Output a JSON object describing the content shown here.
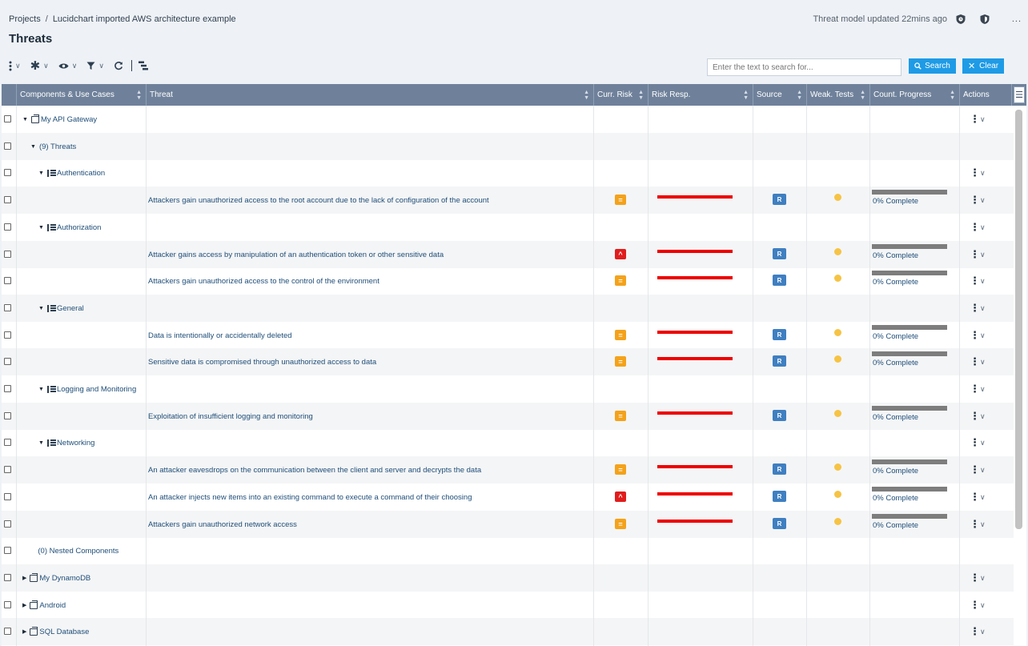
{
  "breadcrumb": {
    "root": "Projects",
    "sep": "/",
    "current": "Lucidchart imported AWS architecture example"
  },
  "page_title": "Threats",
  "header": {
    "updated": "Threat model updated 22mins ago",
    "more": "..."
  },
  "search": {
    "placeholder": "Enter the text to search for...",
    "search_label": "Search",
    "clear_label": "Clear"
  },
  "icons": {
    "search": "search-icon",
    "clear": "close-icon"
  },
  "columns": [
    "Components & Use Cases",
    "Threat",
    "Curr. Risk",
    "Risk Resp.",
    "Source",
    "Weak. Tests",
    "Count. Progress",
    "Actions"
  ],
  "colors": {
    "header_bg": "#6f819a",
    "accent": "#1e9be6",
    "risk_medium": "#f4a21b",
    "risk_high": "#e11d1d",
    "risk_response": "#ee0000",
    "test_dot": "#f6c343",
    "source_badge": "#3f7fc1"
  },
  "rows": [
    {
      "type": "component",
      "level": 0,
      "expanded": true,
      "label": "My API Gateway",
      "actions": true
    },
    {
      "type": "group",
      "level": 1,
      "expanded": true,
      "label": "(9) Threats",
      "actions": false
    },
    {
      "type": "category",
      "level": 2,
      "expanded": true,
      "label": "Authentication",
      "actions": true
    },
    {
      "type": "threat",
      "threat": "Attackers gain unauthorized access to the root account due to the lack of configuration of the account",
      "risk": "medium",
      "risk_symbol": "=",
      "source": "R",
      "progress": "0% Complete",
      "actions": true
    },
    {
      "type": "category",
      "level": 2,
      "expanded": true,
      "label": "Authorization",
      "actions": true
    },
    {
      "type": "threat",
      "threat": "Attacker gains access by manipulation of an authentication token or other sensitive data",
      "risk": "high",
      "risk_symbol": "^",
      "source": "R",
      "progress": "0% Complete",
      "actions": true
    },
    {
      "type": "threat",
      "threat": "Attackers gain unauthorized access to the control of the environment",
      "risk": "medium",
      "risk_symbol": "=",
      "source": "R",
      "progress": "0% Complete",
      "actions": true
    },
    {
      "type": "category",
      "level": 2,
      "expanded": true,
      "label": "General",
      "actions": true
    },
    {
      "type": "threat",
      "threat": "Data is intentionally or accidentally deleted",
      "risk": "medium",
      "risk_symbol": "=",
      "source": "R",
      "progress": "0% Complete",
      "actions": true
    },
    {
      "type": "threat",
      "threat": "Sensitive data is compromised through unauthorized access to data",
      "risk": "medium",
      "risk_symbol": "=",
      "source": "R",
      "progress": "0% Complete",
      "actions": true
    },
    {
      "type": "category",
      "level": 2,
      "expanded": true,
      "label": "Logging and Monitoring",
      "actions": true
    },
    {
      "type": "threat",
      "threat": "Exploitation of insufficient logging and monitoring",
      "risk": "medium",
      "risk_symbol": "=",
      "source": "R",
      "progress": "0% Complete",
      "actions": true
    },
    {
      "type": "category",
      "level": 2,
      "expanded": true,
      "label": "Networking",
      "actions": true
    },
    {
      "type": "threat",
      "threat": "An attacker eavesdrops on the communication between the client and server and decrypts the data",
      "risk": "medium",
      "risk_symbol": "=",
      "source": "R",
      "progress": "0% Complete",
      "actions": true
    },
    {
      "type": "threat",
      "threat": "An attacker injects new items into an existing command to execute a command of their choosing",
      "risk": "high",
      "risk_symbol": "^",
      "source": "R",
      "progress": "0% Complete",
      "actions": true
    },
    {
      "type": "threat",
      "threat": "Attackers gain unauthorized network access",
      "risk": "medium",
      "risk_symbol": "=",
      "source": "R",
      "progress": "0% Complete",
      "actions": true
    },
    {
      "type": "group",
      "level": 1,
      "expanded": false,
      "label": "(0) Nested Components",
      "actions": false
    },
    {
      "type": "component",
      "level": 0,
      "expanded": false,
      "label": "My DynamoDB",
      "actions": true
    },
    {
      "type": "component",
      "level": 0,
      "expanded": false,
      "label": "Android",
      "actions": true
    },
    {
      "type": "component",
      "level": 0,
      "expanded": false,
      "label": "SQL Database",
      "actions": true
    }
  ]
}
